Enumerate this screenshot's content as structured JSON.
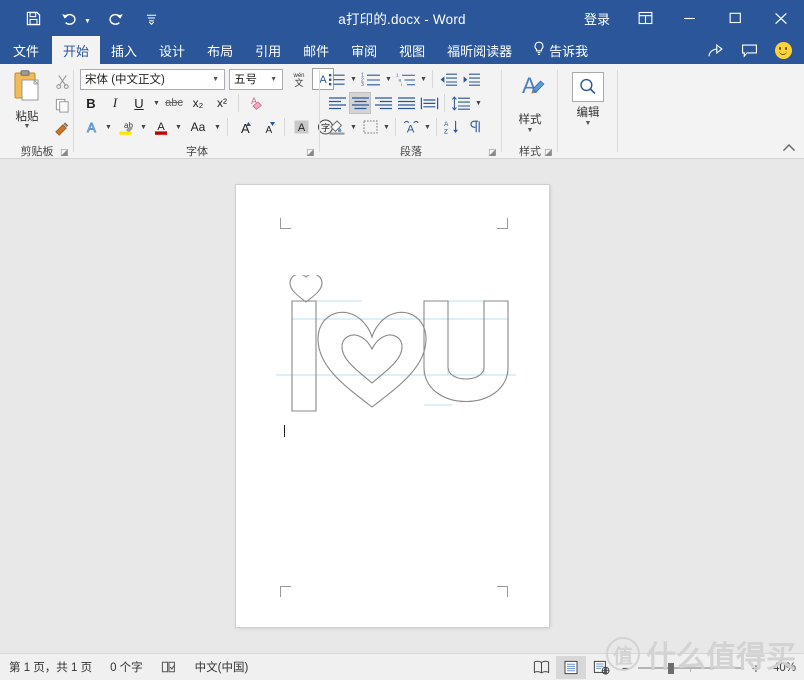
{
  "titlebar": {
    "quick_access": [
      {
        "name": "save-icon",
        "label": "保存"
      },
      {
        "name": "undo-icon",
        "label": "撤消"
      },
      {
        "name": "redo-icon",
        "label": "重复"
      },
      {
        "name": "customize-qat-icon",
        "label": "自定义快速访问工具栏"
      }
    ],
    "document_title": "a打印的.docx  -  Word",
    "signin_label": "登录",
    "ribbon_display_label": "功能区显示选项",
    "minimize_label": "最小化",
    "maximize_label": "最大化",
    "close_label": "关闭"
  },
  "tabs": [
    {
      "label": "文件",
      "active": false
    },
    {
      "label": "开始",
      "active": true
    },
    {
      "label": "插入",
      "active": false
    },
    {
      "label": "设计",
      "active": false
    },
    {
      "label": "布局",
      "active": false
    },
    {
      "label": "引用",
      "active": false
    },
    {
      "label": "邮件",
      "active": false
    },
    {
      "label": "审阅",
      "active": false
    },
    {
      "label": "视图",
      "active": false
    },
    {
      "label": "福昕阅读器",
      "active": false
    }
  ],
  "tellme": {
    "label": "告诉我",
    "icon": "lightbulb-icon"
  },
  "tab_right": [
    {
      "name": "share-icon",
      "label": "共享"
    },
    {
      "name": "comment-icon",
      "label": "批注"
    },
    {
      "name": "smiley-icon",
      "label": "反馈"
    }
  ],
  "ribbon": {
    "clipboard": {
      "group_label": "剪贴板",
      "paste_label": "粘贴",
      "paste_icon": "clipboard-icon",
      "cut_label": "剪切",
      "copy_label": "复制",
      "format_painter_label": "格式刷"
    },
    "font": {
      "group_label": "字体",
      "font_name": "宋体 (中文正文)",
      "font_size": "五号",
      "phonetic_guide_label": "拼音指南",
      "char_border_label": "字符边框",
      "bold": "B",
      "italic": "I",
      "underline": "U",
      "strikethrough": "abc",
      "subscript": "x₂",
      "superscript": "x²",
      "clear_format_label": "清除所有格式",
      "text_effects_label": "文本效果和版式",
      "highlight_label": "文本突出显示颜色",
      "font_color_label": "字体颜色",
      "change_case": "Aa",
      "grow_font_label": "增大字号",
      "shrink_font_label": "减小字号",
      "shading_label": "字符底纹",
      "enclose_char_label": "带圈字符"
    },
    "paragraph": {
      "group_label": "段落",
      "bullets_label": "项目符号",
      "numbering_label": "编号",
      "multilevel_label": "多级列表",
      "decrease_indent_label": "减少缩进量",
      "increase_indent_label": "增加缩进量",
      "align_left_label": "左对齐",
      "align_center_label": "居中",
      "align_right_label": "右对齐",
      "justify_label": "两端对齐",
      "distribute_label": "分散对齐",
      "line_spacing_label": "行和段落间距",
      "shading_label": "底纹",
      "borders_label": "边框",
      "cn_layout_label": "中文版式",
      "sort_label": "排序",
      "show_marks_label": "显示/隐藏编辑标记",
      "active_alignment": "居中"
    },
    "styles": {
      "group_label": "样式",
      "button_label": "样式",
      "icon": "styles-icon"
    },
    "editing": {
      "group_label": "",
      "button_label": "编辑",
      "icon": "search-icon"
    },
    "collapse_label": "折叠功能区"
  },
  "document": {
    "artwork_name": "i-heart-u-outline-artwork",
    "artwork_description": "I ♥ U 轮廓图",
    "outline_color": "#8a8a8a",
    "guide_color": "#bcdff2"
  },
  "statusbar": {
    "page_info": "第 1 页，共 1 页",
    "word_count": "0 个字",
    "proofing_icon_label": "校对",
    "language": "中文(中国)",
    "views": [
      {
        "name": "read-mode-view",
        "label": "阅读视图",
        "active": false
      },
      {
        "name": "print-layout-view",
        "label": "页面视图",
        "active": true
      },
      {
        "name": "web-layout-view",
        "label": "Web 版式视图",
        "active": false
      }
    ],
    "zoom_out_label": "缩小",
    "zoom_in_label": "放大",
    "zoom_value": "40%"
  },
  "watermark": {
    "badge": "值",
    "text": "什么值得买"
  },
  "colors": {
    "word_blue": "#2b579a",
    "ribbon_bg": "#f3f3f3",
    "doc_bg": "#e8e8e8",
    "status_bg": "#f0f0f0",
    "icon_blue": "#2b579a"
  }
}
